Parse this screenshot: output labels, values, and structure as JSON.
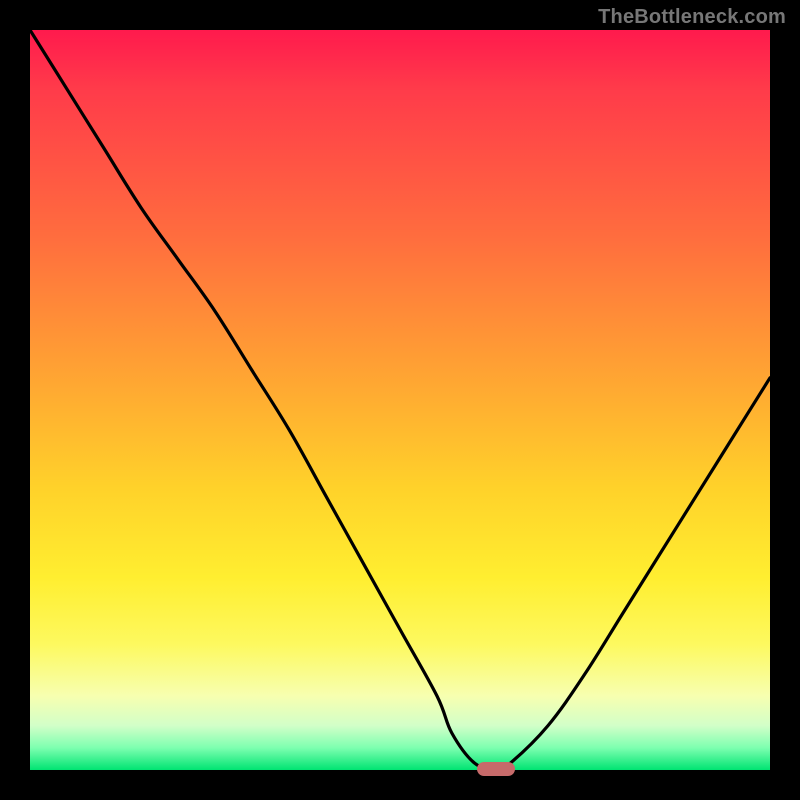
{
  "attribution": "TheBottleneck.com",
  "colors": {
    "frame": "#000000",
    "gradient_top": "#ff1a4d",
    "gradient_mid": "#ffd22a",
    "gradient_bottom": "#00e472",
    "curve": "#000000",
    "marker": "#c66a6a"
  },
  "chart_data": {
    "type": "line",
    "title": "",
    "xlabel": "",
    "ylabel": "",
    "xlim": [
      0,
      100
    ],
    "ylim": [
      0,
      100
    ],
    "x": [
      0,
      5,
      10,
      15,
      20,
      25,
      30,
      35,
      40,
      45,
      50,
      55,
      57,
      60,
      63,
      65,
      70,
      75,
      80,
      85,
      90,
      95,
      100
    ],
    "values": [
      100,
      92,
      84,
      76,
      69,
      62,
      54,
      46,
      37,
      28,
      19,
      10,
      5,
      1,
      0,
      1,
      6,
      13,
      21,
      29,
      37,
      45,
      53
    ],
    "marker_x": 63,
    "marker_y": 0,
    "note": "x and y are percentages of plot width/height; y=0 is bottom, y=100 is top"
  }
}
